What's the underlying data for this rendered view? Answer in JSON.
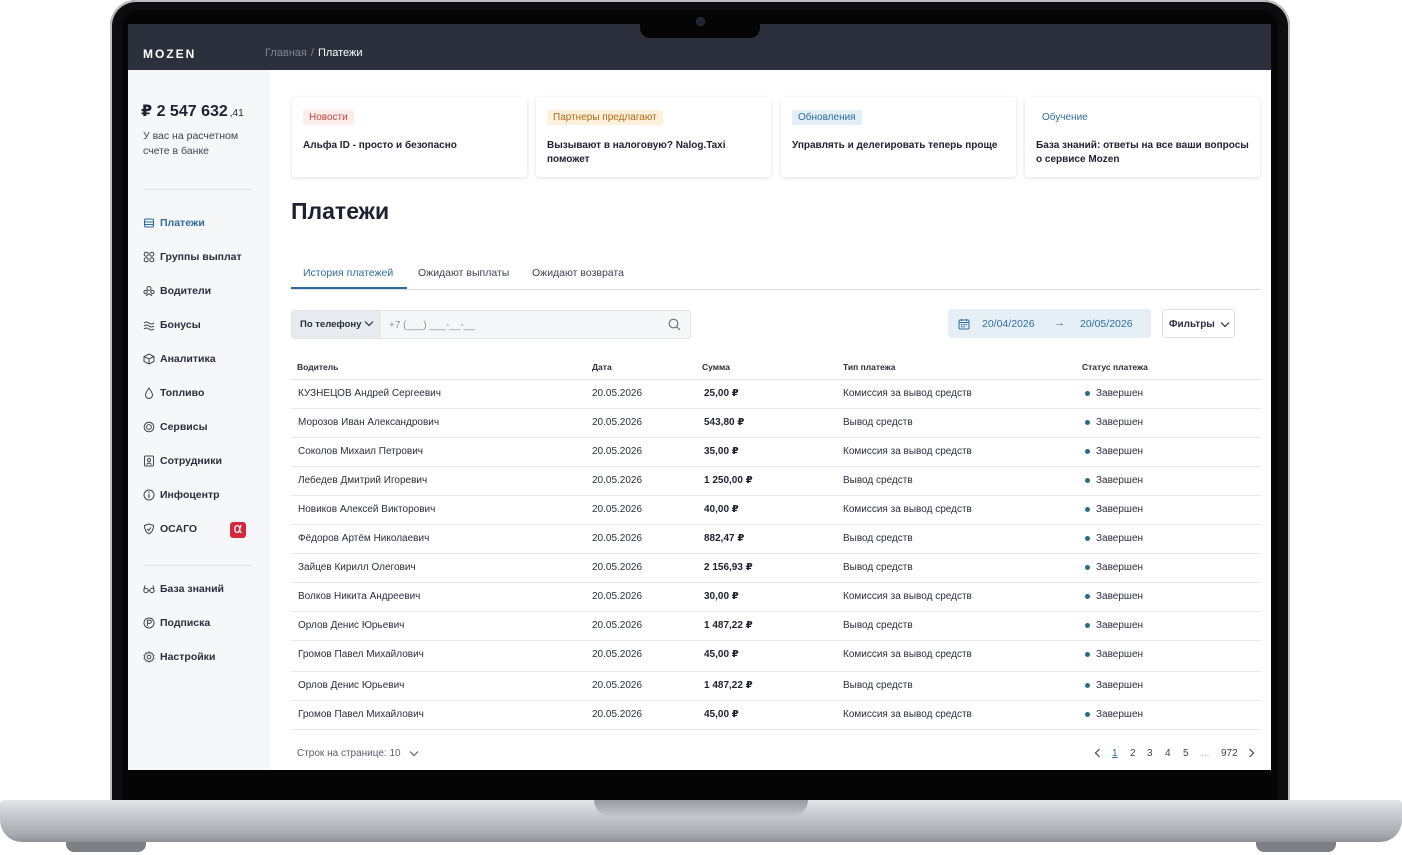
{
  "app": {
    "logo": "MOZEN"
  },
  "breadcrumb": {
    "home": "Главная",
    "separator": "/",
    "current": "Платежи"
  },
  "balance": {
    "amount": "₽ 2 547 632",
    "kopecks": ",41",
    "caption": "У вас на расчетном счете в банке"
  },
  "nav": {
    "items": [
      {
        "label": "Платежи",
        "icon": "wallet-icon",
        "active": true
      },
      {
        "label": "Группы выплат",
        "icon": "groups-icon"
      },
      {
        "label": "Водители",
        "icon": "drivers-icon"
      },
      {
        "label": "Бонусы",
        "icon": "bonus-icon"
      },
      {
        "label": "Аналитика",
        "icon": "analytics-icon"
      },
      {
        "label": "Топливо",
        "icon": "fuel-icon"
      },
      {
        "label": "Сервисы",
        "icon": "services-icon"
      },
      {
        "label": "Сотрудники",
        "icon": "employees-icon"
      },
      {
        "label": "Инфоцентр",
        "icon": "info-icon"
      },
      {
        "label": "ОСАГО",
        "icon": "shield-icon",
        "badge": "α"
      }
    ],
    "bottom_items": [
      {
        "label": "База знаний",
        "icon": "glasses-icon"
      },
      {
        "label": "Подписка",
        "icon": "subscription-icon"
      },
      {
        "label": "Настройки",
        "icon": "gear-icon"
      }
    ]
  },
  "news_cards": [
    {
      "tag": "Новости",
      "text": "Альфа ID - просто и безопасно",
      "tag_bg": "#fdeeec",
      "tag_color": "#c8433a"
    },
    {
      "tag": "Партнеры предлагают",
      "text": "Вызывают в налоговую? Nalog.Taxi поможет",
      "tag_bg": "#fdf1dc",
      "tag_color": "#b26a17"
    },
    {
      "tag": "Обновления",
      "text": "Управлять и делегировать теперь проще",
      "tag_bg": "#e4eef6",
      "tag_color": "#2e6c9e"
    },
    {
      "tag": "Обучение",
      "text": "База знаний: ответы на все ваши вопросы о сервисе Mozen",
      "tag_bg": "#ffffff",
      "tag_color": "#2e6c9e"
    }
  ],
  "page": {
    "title": "Платежи"
  },
  "tabs": [
    {
      "label": "История платежей",
      "active": true
    },
    {
      "label": "Ожидают выплаты"
    },
    {
      "label": "Ожидают возврата"
    }
  ],
  "search": {
    "mode_label": "По телефону",
    "placeholder": "+7 (___) ___-__-__",
    "value": ""
  },
  "date_range": {
    "from": "20/04/2026",
    "to": "20/05/2026"
  },
  "filters": {
    "label": "Фильтры"
  },
  "table": {
    "columns": [
      "Водитель",
      "Дата",
      "Сумма",
      "Тип платежа",
      "Статус платежа"
    ],
    "rows": [
      {
        "driver": "КУЗНЕЦОВ Андрей Сергеевич",
        "date": "20.05.2026",
        "amount": "25,00 ₽",
        "type": "Комиссия за вывод средств",
        "status": "Завершен"
      },
      {
        "driver": "Морозов Иван Александрович",
        "date": "20.05.2026",
        "amount": "543,80 ₽",
        "type": "Вывод средств",
        "status": "Завершен"
      },
      {
        "driver": "Соколов Михаил Петрович",
        "date": "20.05.2026",
        "amount": "35,00 ₽",
        "type": "Комиссия за вывод средств",
        "status": "Завершен"
      },
      {
        "driver": "Лебедев Дмитрий Игоревич",
        "date": "20.05.2026",
        "amount": "1 250,00 ₽",
        "type": "Вывод средств",
        "status": "Завершен"
      },
      {
        "driver": "Новиков Алексей Викторович",
        "date": "20.05.2026",
        "amount": "40,00 ₽",
        "type": "Комиссия за вывод средств",
        "status": "Завершен"
      },
      {
        "driver": "Фёдоров Артём Николаевич",
        "date": "20.05.2026",
        "amount": "882,47 ₽",
        "type": "Вывод средств",
        "status": "Завершен"
      },
      {
        "driver": "Зайцев Кирилл Олегович",
        "date": "20.05.2026",
        "amount": "2 156,93 ₽",
        "type": "Вывод средств",
        "status": "Завершен"
      },
      {
        "driver": "Волков Никита Андреевич",
        "date": "20.05.2026",
        "amount": "30,00 ₽",
        "type": "Комиссия за вывод средств",
        "status": "Завершен"
      },
      {
        "driver": "Орлов Денис Юрьевич",
        "date": "20.05.2026",
        "amount": "1 487,22 ₽",
        "type": "Вывод средств",
        "status": "Завершен"
      },
      {
        "driver": "Громов Павел Михайлович",
        "date": "20.05.2026",
        "amount": "45,00 ₽",
        "type": "Комиссия за вывод средств",
        "status": "Завершен"
      },
      {
        "driver": "Орлов Денис Юрьевич",
        "date": "20.05.2026",
        "amount": "1 487,22 ₽",
        "type": "Вывод средств",
        "status": "Завершен"
      },
      {
        "driver": "Громов Павел Михайлович",
        "date": "20.05.2026",
        "amount": "45,00 ₽",
        "type": "Комиссия за вывод средств",
        "status": "Завершен"
      }
    ]
  },
  "pagination": {
    "rows_per_page_label": "Строк на странице: 10",
    "pages": [
      "1",
      "2",
      "3",
      "4",
      "5"
    ],
    "ellipsis": "...",
    "last_page": "972",
    "current_page": "1"
  },
  "colors": {
    "accent": "#2e6c9e",
    "topbar": "#2c303d",
    "status_dot": "#2b6b83",
    "osago_badge": "#d5283d"
  }
}
